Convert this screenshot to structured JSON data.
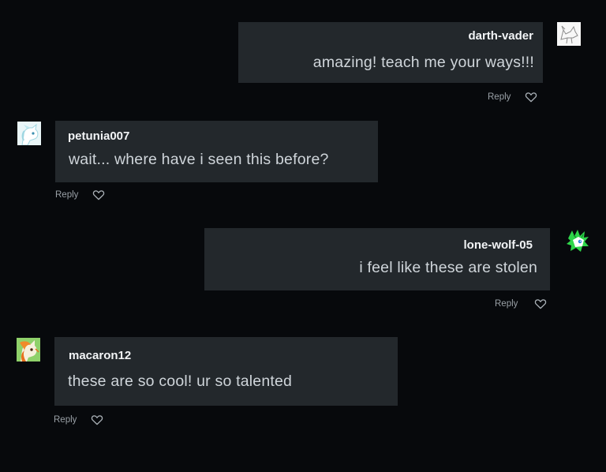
{
  "comments": [
    {
      "username": "darth-vader",
      "text": "amazing! teach me your ways!!!",
      "reply_label": "Reply",
      "like_icon": "heart-outline-icon",
      "avatar_icon": "sketch-wolf-avatar-icon"
    },
    {
      "username": "petunia007",
      "text": "wait... where have i seen this before?",
      "reply_label": "Reply",
      "like_icon": "heart-outline-icon",
      "avatar_icon": "white-pony-avatar-icon"
    },
    {
      "username": "lone-wolf-05",
      "text": "i feel like these are stolen",
      "reply_label": "Reply",
      "like_icon": "heart-outline-icon",
      "avatar_icon": "green-wolf-avatar-icon"
    },
    {
      "username": "macaron12",
      "text": "these are so cool! ur so talented",
      "reply_label": "Reply",
      "like_icon": "heart-outline-icon",
      "avatar_icon": "orange-pony-avatar-icon"
    }
  ],
  "colors": {
    "background": "#07090c",
    "bubble": "#23282c",
    "username": "#f2f4f6",
    "text": "#cfd5da",
    "meta": "#9aa1a7"
  }
}
